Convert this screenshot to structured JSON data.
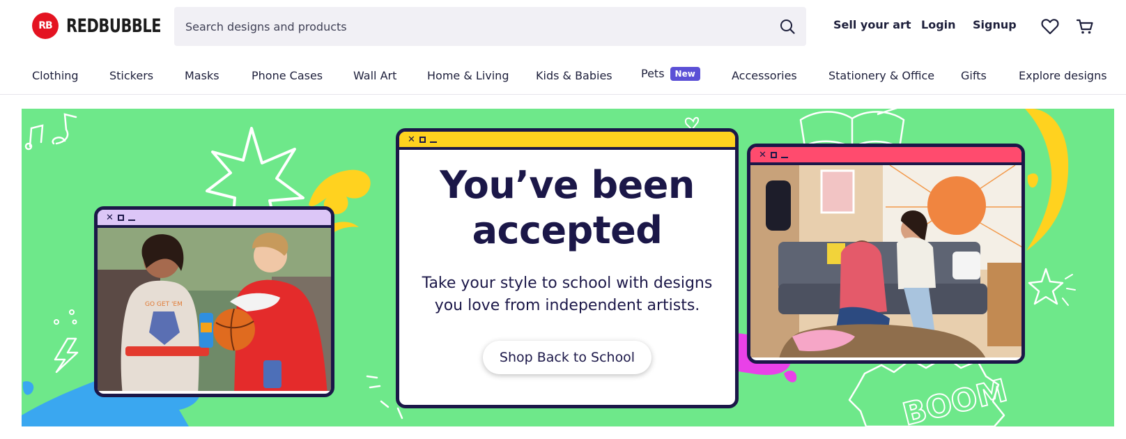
{
  "header": {
    "logo_mark": "RB",
    "logo_text": "REDBUBBLE",
    "search_placeholder": "Search designs and products",
    "links": {
      "sell": "Sell your art",
      "login": "Login",
      "signup": "Signup"
    },
    "icons": {
      "search": "search-icon",
      "wishlist": "heart-icon",
      "cart": "cart-icon"
    }
  },
  "nav": {
    "clothing": "Clothing",
    "stickers": "Stickers",
    "masks": "Masks",
    "phone_cases": "Phone Cases",
    "wall_art": "Wall Art",
    "home_living": "Home & Living",
    "kids_babies": "Kids & Babies",
    "pets": "Pets",
    "pets_badge": "New",
    "accessories": "Accessories",
    "stationery": "Stationery & Office",
    "gifts": "Gifts",
    "explore": "Explore designs"
  },
  "banner": {
    "headline_line1": "You’ve been",
    "headline_line2": "accepted",
    "subtext_line1": "Take your style to school with designs",
    "subtext_line2": "you love from independent artists.",
    "cta": "Shop Back to School",
    "badge_left_mug": "GO GET 'EM",
    "boom_text": "BOOM",
    "colors": {
      "background": "#6ee88a",
      "left_window_bar": "#dcc6f7",
      "center_window_bar": "#ffd21f",
      "right_window_bar": "#ff4b6e",
      "outline": "#1b1748",
      "blue_splash": "#3aa7f0",
      "yellow_splash": "#ffd21f",
      "magenta_splash": "#e941e8"
    }
  },
  "colors": {
    "brand_red": "#e41321",
    "text_dark": "#1c1e3a",
    "search_bg": "#f1f0f5",
    "new_badge": "#5b50d6"
  }
}
